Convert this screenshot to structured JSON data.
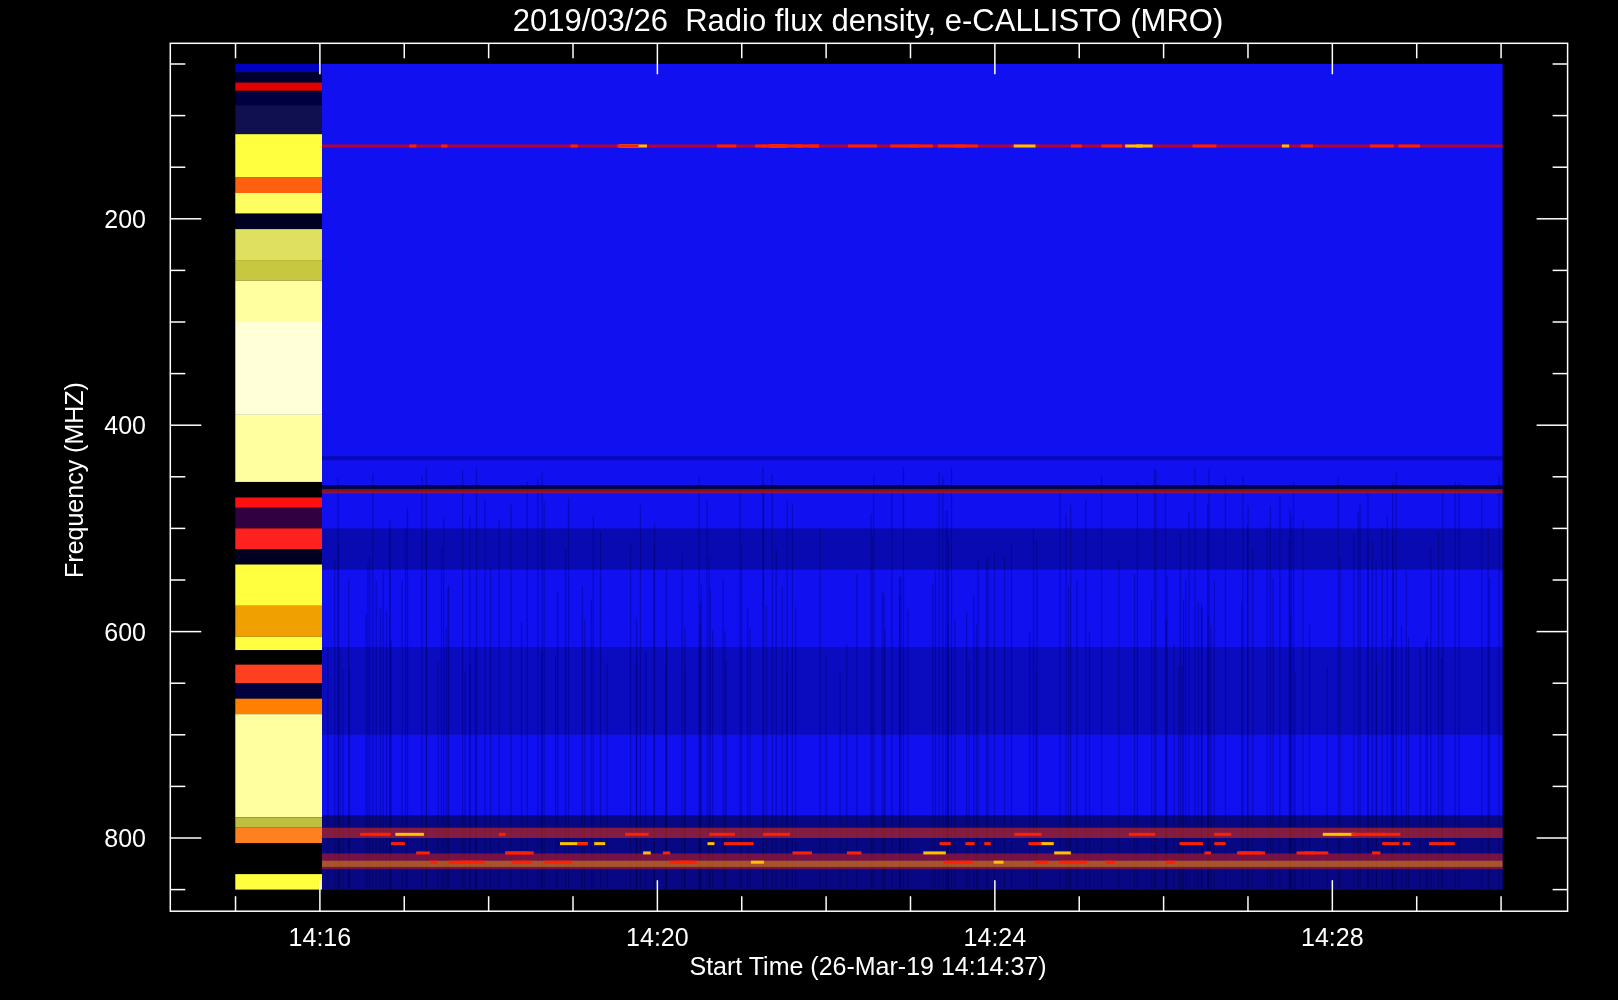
{
  "title": "2019/03/26  Radio flux density, e-CALLISTO (MRO)",
  "y_axis": {
    "label": "Frequency (MHZ)",
    "ticks": [
      "200",
      "400",
      "600",
      "800"
    ]
  },
  "x_axis": {
    "label": "Start Time (26-Mar-19 14:14:37)",
    "ticks": [
      "14:16",
      "14:20",
      "14:24",
      "14:28"
    ]
  }
}
